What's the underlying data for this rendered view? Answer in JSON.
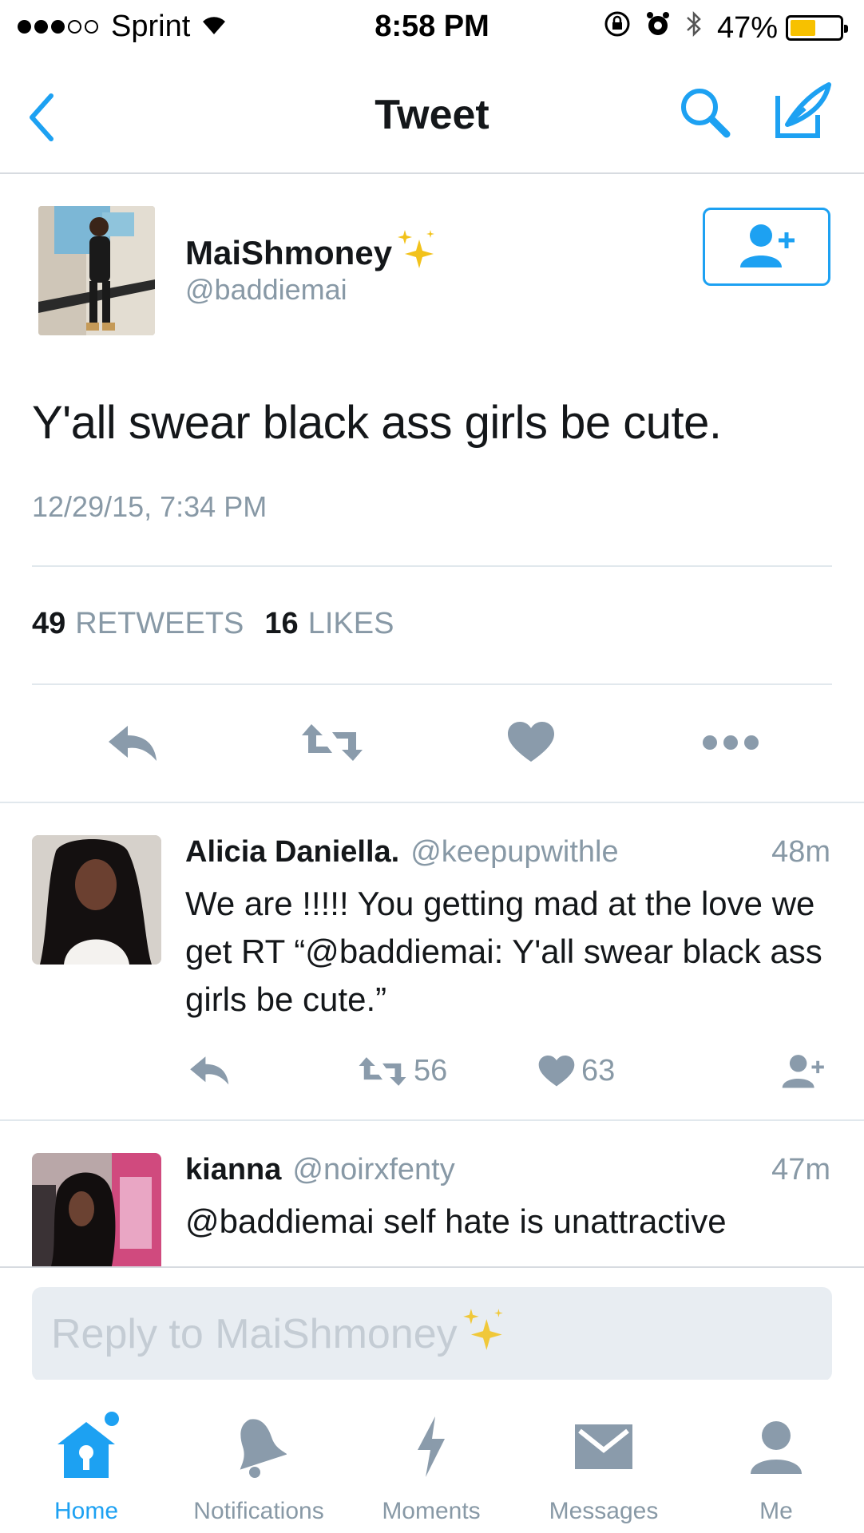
{
  "status_bar": {
    "carrier": "Sprint",
    "time": "8:58 PM",
    "battery": "47%",
    "battery_level": 0.47,
    "icons": [
      "signal-dots",
      "wifi-icon",
      "rotation-lock-icon",
      "alarm-icon",
      "bluetooth-icon",
      "battery-icon"
    ]
  },
  "nav": {
    "title": "Tweet",
    "icons": [
      "back-chevron-icon",
      "search-icon",
      "compose-icon"
    ]
  },
  "tweet": {
    "author_name": "MaiShmoney",
    "author_handle": "@baddiemai",
    "text": "Y'all swear black ass girls be cute.",
    "timestamp": "12/29/15, 7:34 PM",
    "retweets_count": "49",
    "retweets_label": "RETWEETS",
    "likes_count": "16",
    "likes_label": "LIKES",
    "follow_icon": "follow-user-icon",
    "action_icons": [
      "reply-icon",
      "retweet-icon",
      "like-icon",
      "more-icon"
    ]
  },
  "replies": [
    {
      "name": "Alicia Daniella.",
      "handle": "@keepupwithle",
      "age": "48m",
      "text": "We are !!!!! You getting mad at the love we get RT “@baddiemai: Y'all swear black ass girls be cute.”",
      "retweets": "56",
      "likes": "63"
    },
    {
      "name": "kianna",
      "handle": "@noirxfenty",
      "age": "47m",
      "text": "@baddiemai self hate is unattractive"
    }
  ],
  "composer": {
    "placeholder": "Reply to MaiShmoney"
  },
  "tabs": [
    {
      "label": "Home",
      "icon": "home-icon",
      "active": true
    },
    {
      "label": "Notifications",
      "icon": "bell-icon",
      "active": false
    },
    {
      "label": "Moments",
      "icon": "lightning-icon",
      "active": false
    },
    {
      "label": "Messages",
      "icon": "envelope-icon",
      "active": false
    },
    {
      "label": "Me",
      "icon": "person-icon",
      "active": false
    }
  ],
  "colors": {
    "accent": "#1da1f2",
    "muted": "#8899a6",
    "icon_gray": "#8a9bab",
    "divider": "#e1e8ed",
    "sparkle": "#f2c21b",
    "battery_fill": "#f7c100"
  }
}
